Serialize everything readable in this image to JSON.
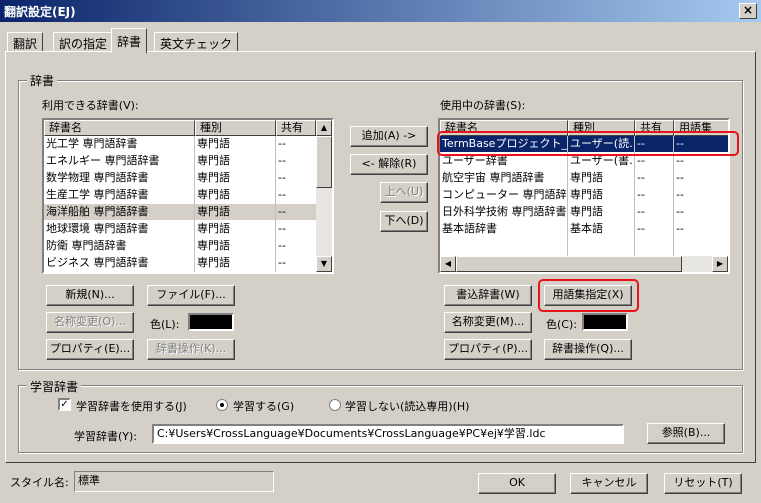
{
  "window": {
    "title": "翻訳設定(EJ)",
    "close_glyph": "×"
  },
  "tabs": [
    {
      "label": "翻訳"
    },
    {
      "label": "訳の指定"
    },
    {
      "label": "辞書"
    },
    {
      "label": "英文チェック"
    }
  ],
  "dictionary_group": {
    "legend": "辞書",
    "available": {
      "label": "利用できる辞書(V):",
      "columns": [
        "辞書名",
        "種別",
        "共有"
      ],
      "rows": [
        [
          "光工学 専門語辞書",
          "専門語",
          "--"
        ],
        [
          "エネルギー 専門語辞書",
          "専門語",
          "--"
        ],
        [
          "数学物理 専門語辞書",
          "専門語",
          "--"
        ],
        [
          "生産工学 専門語辞書",
          "専門語",
          "--"
        ],
        [
          "海洋船舶 専門語辞書",
          "専門語",
          "--"
        ],
        [
          "地球環境 専門語辞書",
          "専門語",
          "--"
        ],
        [
          "防衛 専門語辞書",
          "専門語",
          "--"
        ],
        [
          "ビジネス 専門語辞書",
          "専門語",
          "--"
        ]
      ]
    },
    "in_use": {
      "label": "使用中の辞書(S):",
      "columns": [
        "辞書名",
        "種別",
        "共有",
        "用語集"
      ],
      "rows": [
        [
          "TermBaseプロジェクト_01",
          "ユーザー(読…",
          "--",
          "--"
        ],
        [
          "ユーザー辞書",
          "ユーザー(書…",
          "--",
          "--"
        ],
        [
          "航空宇宙 専門語辞書",
          "専門語",
          "--",
          "--"
        ],
        [
          "コンピューター 専門語辞書",
          "専門語",
          "--",
          "--"
        ],
        [
          "日外科学技術 専門語辞書",
          "専門語",
          "--",
          "--"
        ],
        [
          "基本語辞書",
          "基本語",
          "--",
          "--"
        ]
      ]
    },
    "buttons": {
      "add": "追加(A) ->",
      "remove": "<- 解除(R)",
      "up": "上へ(U)",
      "down": "下へ(D)",
      "new": "新規(N)...",
      "file": "ファイル(F)...",
      "rename_left": "名称変更(O)...",
      "properties_left": "プロパティ(E)...",
      "dict_ops_left": "辞書操作(K)...",
      "write_dict": "書込辞書(W)",
      "glossary": "用語集指定(X)",
      "rename_right": "名称変更(M)...",
      "properties_right": "プロパティ(P)...",
      "dict_ops_right": "辞書操作(Q)..."
    },
    "color_left_label": "色(L):",
    "color_right_label": "色(C):"
  },
  "learning_group": {
    "legend": "学習辞書",
    "use_checkbox": "学習辞書を使用する(J)",
    "radio_learn": "学習する(G)",
    "radio_nolearn": "学習しない(読込専用)(H)",
    "path_label": "学習辞書(Y):",
    "path_value": "C:¥Users¥CrossLanguage¥Documents¥CrossLanguage¥PC¥ej¥学習.ldc",
    "browse": "参照(B)..."
  },
  "footer": {
    "style_label": "スタイル名:",
    "style_value": "標準",
    "ok": "OK",
    "cancel": "キャンセル",
    "reset": "リセット(T)"
  }
}
